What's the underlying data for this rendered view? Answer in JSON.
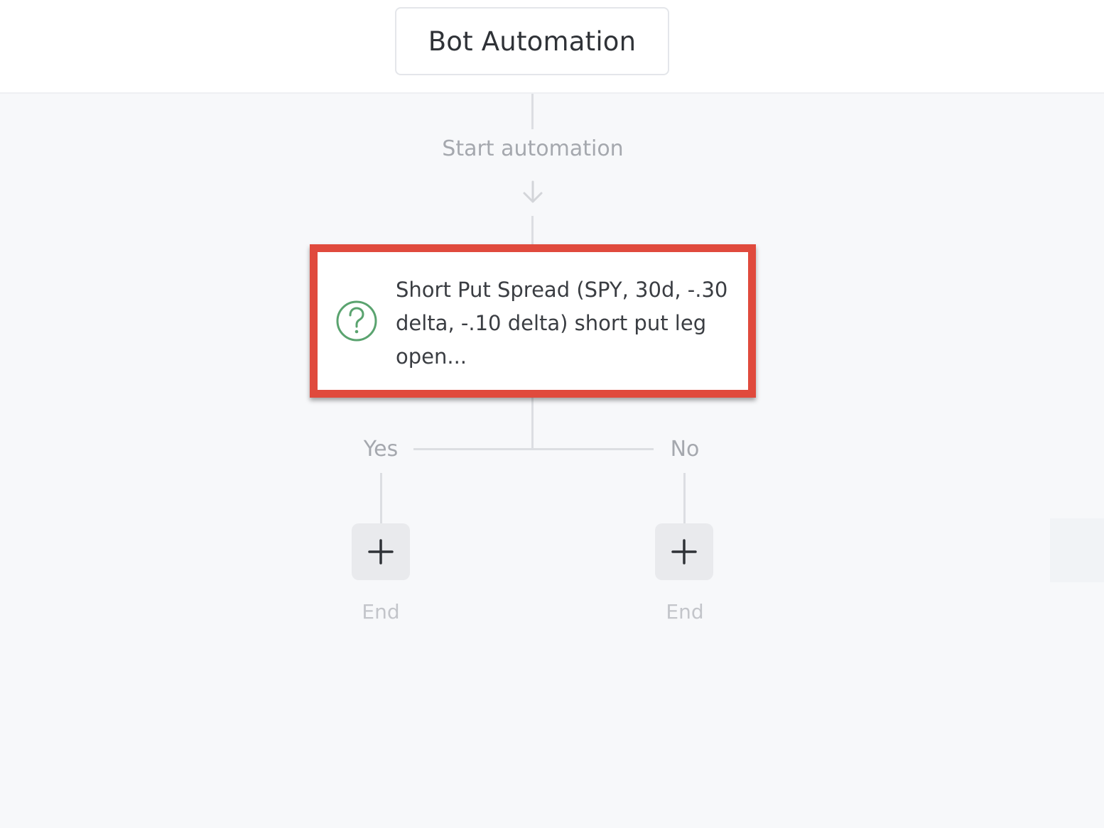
{
  "header": {
    "title": "Bot Automation"
  },
  "flow": {
    "start_label": "Start automation",
    "condition": {
      "icon": "question-circle-icon",
      "text": "Short Put Spread (SPY, 30d, -.30 delta, -.10 delta) short put leg open..."
    },
    "branches": {
      "yes": {
        "label": "Yes",
        "add_icon": "plus-icon",
        "end_label": "End"
      },
      "no": {
        "label": "No",
        "add_icon": "plus-icon",
        "end_label": "End"
      }
    }
  },
  "colors": {
    "highlight": "#e04a3d",
    "icon_green": "#5aa36f",
    "canvas": "#f7f8fa"
  }
}
